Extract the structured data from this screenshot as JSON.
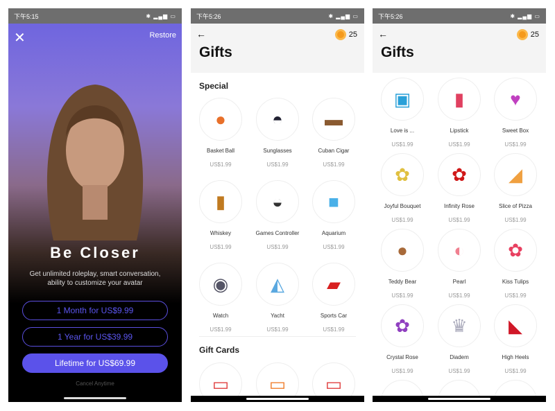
{
  "paywall": {
    "status_time": "下午5:15",
    "close_icon": "close-icon",
    "restore": "Restore",
    "title": "Be Closer",
    "subtitle": "Get unlimited roleplay, smart conversation, ability to customize your avatar",
    "plans": [
      "1 Month for US$9.99",
      "1 Year for US$39.99",
      "Lifetime for US$69.99"
    ],
    "cancel": "Cancel Anytime",
    "accent": "#5b52ea"
  },
  "gifts1": {
    "status_time": "下午5:26",
    "title": "Gifts",
    "coins": "25",
    "section_special": "Special",
    "section_cards": "Gift Cards",
    "items": [
      {
        "name": "Basket Ball",
        "price": "US$1.99",
        "icon": "basketball-icon"
      },
      {
        "name": "Sunglasses",
        "price": "US$1.99",
        "icon": "sunglasses-icon"
      },
      {
        "name": "Cuban Cigar",
        "price": "US$1.99",
        "icon": "cigar-icon"
      },
      {
        "name": "Whiskey",
        "price": "US$1.99",
        "icon": "whiskey-icon"
      },
      {
        "name": "Games Controller",
        "price": "US$1.99",
        "icon": "controller-icon"
      },
      {
        "name": "Aquarium",
        "price": "US$1.99",
        "icon": "aquarium-icon"
      },
      {
        "name": "Watch",
        "price": "US$1.99",
        "icon": "watch-icon"
      },
      {
        "name": "Yacht",
        "price": "US$1.99",
        "icon": "yacht-icon"
      },
      {
        "name": "Sports Car",
        "price": "US$1.99",
        "icon": "car-icon"
      }
    ]
  },
  "gifts2": {
    "status_time": "下午5:26",
    "title": "Gifts",
    "coins": "25",
    "items": [
      {
        "name": "Love is ...",
        "price": "US$1.99",
        "icon": "love-is-icon"
      },
      {
        "name": "Lipstick",
        "price": "US$1.99",
        "icon": "lipstick-icon"
      },
      {
        "name": "Sweet Box",
        "price": "US$1.99",
        "icon": "heart-box-icon"
      },
      {
        "name": "Joyful Bouquet",
        "price": "US$1.99",
        "icon": "bouquet-icon"
      },
      {
        "name": "Infinity Rose",
        "price": "US$1.99",
        "icon": "rose-icon"
      },
      {
        "name": "Slice of Pizza",
        "price": "US$1.99",
        "icon": "pizza-icon"
      },
      {
        "name": "Teddy Bear",
        "price": "US$1.99",
        "icon": "teddy-bear-icon"
      },
      {
        "name": "Pearl",
        "price": "US$1.99",
        "icon": "pearl-icon"
      },
      {
        "name": "Kiss Tulips",
        "price": "US$1.99",
        "icon": "tulips-icon"
      },
      {
        "name": "Crystal Rose",
        "price": "US$1.99",
        "icon": "crystal-rose-icon"
      },
      {
        "name": "Diadem",
        "price": "US$1.99",
        "icon": "diadem-icon"
      },
      {
        "name": "High Heels",
        "price": "US$1.99",
        "icon": "high-heels-icon"
      }
    ]
  }
}
